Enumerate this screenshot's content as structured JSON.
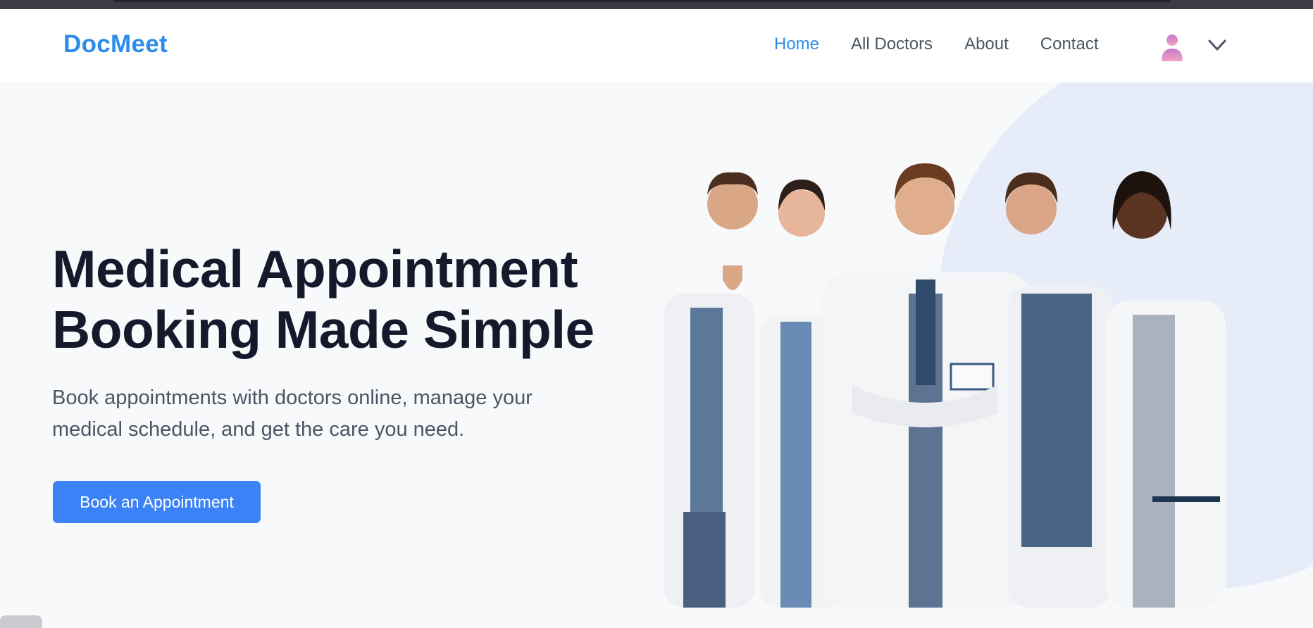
{
  "app": {
    "brand": "DocMeet"
  },
  "nav": {
    "links": [
      {
        "label": "Home",
        "active": true
      },
      {
        "label": "All Doctors",
        "active": false
      },
      {
        "label": "About",
        "active": false
      },
      {
        "label": "Contact",
        "active": false
      }
    ]
  },
  "hero": {
    "headline_line1": "Medical Appointment",
    "headline_line2": "Booking Made Simple",
    "subtitle_line1": "Book appointments with doctors online, manage your",
    "subtitle_line2": "medical schedule, and get the care you need.",
    "cta_label": "Book an Appointment"
  },
  "icons": {
    "avatar": "user-avatar-icon",
    "chevron": "chevron-down-icon"
  },
  "colors": {
    "brand": "#2d8ce9",
    "cta": "#3b82f6",
    "headline": "#141a2b",
    "body_text": "#4b5563",
    "hero_bg": "#f8f9fb",
    "blob": "#e6edf9"
  }
}
